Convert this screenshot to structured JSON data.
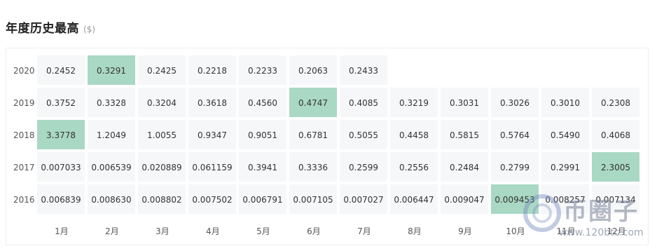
{
  "header": {
    "title": "年度历史最高",
    "unit": "($)"
  },
  "table": {
    "months": [
      "1月",
      "2月",
      "3月",
      "4月",
      "5月",
      "6月",
      "7月",
      "8月",
      "9月",
      "10月",
      "11月",
      "12月"
    ],
    "rows": [
      {
        "year": "2020",
        "values": [
          "0.2452",
          "0.3291",
          "0.2425",
          "0.2218",
          "0.2233",
          "0.2063",
          "0.2433",
          "",
          "",
          "",
          "",
          ""
        ],
        "highlight": 1
      },
      {
        "year": "2019",
        "values": [
          "0.3752",
          "0.3328",
          "0.3204",
          "0.3618",
          "0.4560",
          "0.4747",
          "0.4085",
          "0.3219",
          "0.3031",
          "0.3026",
          "0.3010",
          "0.2308"
        ],
        "highlight": 5
      },
      {
        "year": "2018",
        "values": [
          "3.3778",
          "1.2049",
          "1.0055",
          "0.9347",
          "0.9051",
          "0.6781",
          "0.5055",
          "0.4458",
          "0.5815",
          "0.5764",
          "0.5490",
          "0.4068"
        ],
        "highlight": 0
      },
      {
        "year": "2017",
        "values": [
          "0.007033",
          "0.006539",
          "0.020889",
          "0.061159",
          "0.3941",
          "0.3336",
          "0.2599",
          "0.2556",
          "0.2484",
          "0.2799",
          "0.2991",
          "2.3005"
        ],
        "highlight": 11
      },
      {
        "year": "2016",
        "values": [
          "0.006839",
          "0.008630",
          "0.008802",
          "0.007502",
          "0.006791",
          "0.007105",
          "0.007027",
          "0.006447",
          "0.009047",
          "0.009453",
          "0.008257",
          "0.007134"
        ],
        "highlight": 9
      }
    ],
    "highlight_color": "#a9d8c4"
  },
  "watermark": {
    "text": "币圈子",
    "url": "www.120btc.com"
  }
}
